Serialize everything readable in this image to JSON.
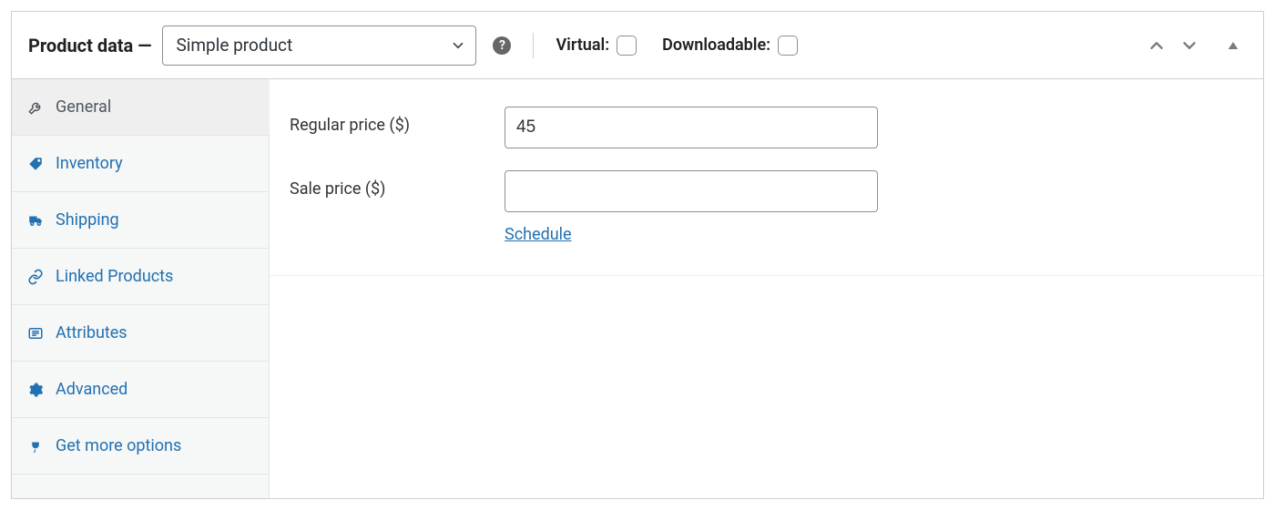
{
  "header": {
    "title": "Product data —",
    "product_type_selected": "Simple product",
    "virtual_label": "Virtual:",
    "virtual_checked": false,
    "downloadable_label": "Downloadable:",
    "downloadable_checked": false
  },
  "tabs": [
    {
      "key": "general",
      "label": "General",
      "active": true
    },
    {
      "key": "inventory",
      "label": "Inventory",
      "active": false
    },
    {
      "key": "shipping",
      "label": "Shipping",
      "active": false
    },
    {
      "key": "linked_products",
      "label": "Linked Products",
      "active": false
    },
    {
      "key": "attributes",
      "label": "Attributes",
      "active": false
    },
    {
      "key": "advanced",
      "label": "Advanced",
      "active": false
    },
    {
      "key": "more_options",
      "label": "Get more options",
      "active": false
    }
  ],
  "fields": {
    "regular_price": {
      "label": "Regular price ($)",
      "value": "45"
    },
    "sale_price": {
      "label": "Sale price ($)",
      "value": "",
      "schedule_link": "Schedule"
    }
  },
  "colors": {
    "link": "#2271b1",
    "border": "#ccd0d4",
    "input_border": "#8c8f94",
    "tab_bg": "#f6f7f7",
    "tab_active_bg": "#efefef",
    "muted_text": "#50575e"
  }
}
